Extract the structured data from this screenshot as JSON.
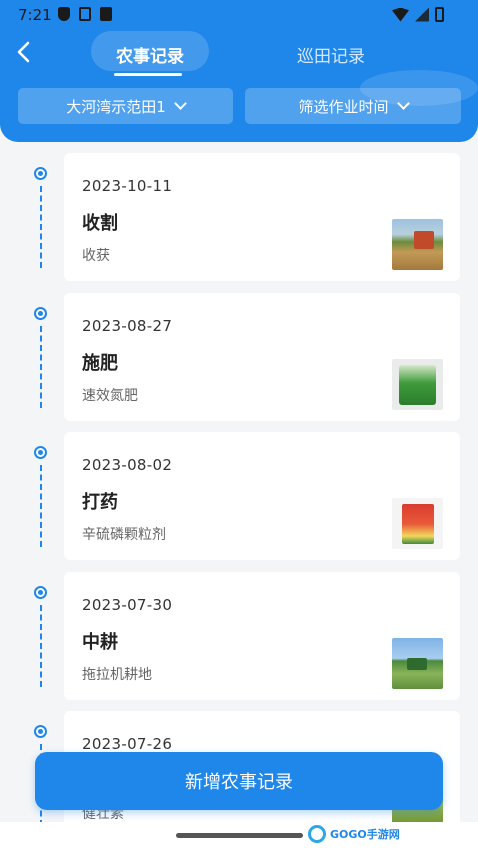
{
  "status_bar": {
    "time": "7:21"
  },
  "header": {
    "tabs": [
      {
        "label": "农事记录",
        "active": true
      },
      {
        "label": "巡田记录",
        "active": false
      }
    ],
    "filters": {
      "field": "大河湾示范田1",
      "time": "筛选作业时间"
    }
  },
  "records": [
    {
      "date": "2023-10-11",
      "task": "收割",
      "detail": "收获",
      "image_icon": "harvester-photo"
    },
    {
      "date": "2023-08-27",
      "task": "施肥",
      "detail": "速效氮肥",
      "image_icon": "fertilizer-bag-photo"
    },
    {
      "date": "2023-08-02",
      "task": "打药",
      "detail": "辛硫磷颗粒剂",
      "image_icon": "pesticide-pack-photo"
    },
    {
      "date": "2023-07-30",
      "task": "中耕",
      "detail": "拖拉机耕地",
      "image_icon": "tractor-photo"
    },
    {
      "date": "2023-07-26",
      "task": "",
      "detail": "健壮素",
      "image_icon": "crop-photo"
    }
  ],
  "add_button": {
    "label": "新增农事记录"
  },
  "watermark": {
    "text": "GOGO手游网"
  },
  "colors": {
    "primary": "#1f87ea",
    "background": "#f4f5f7",
    "card": "#ffffff"
  }
}
